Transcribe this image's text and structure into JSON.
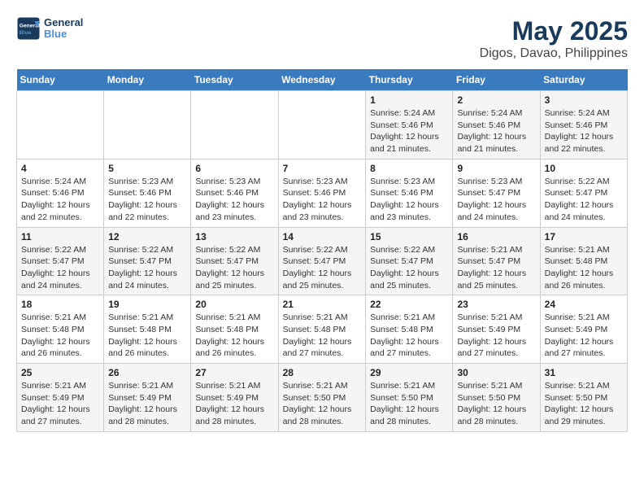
{
  "header": {
    "logo_general": "General",
    "logo_blue": "Blue",
    "title": "May 2025",
    "subtitle": "Digos, Davao, Philippines"
  },
  "calendar": {
    "days_of_week": [
      "Sunday",
      "Monday",
      "Tuesday",
      "Wednesday",
      "Thursday",
      "Friday",
      "Saturday"
    ],
    "weeks": [
      [
        {
          "day": "",
          "info": ""
        },
        {
          "day": "",
          "info": ""
        },
        {
          "day": "",
          "info": ""
        },
        {
          "day": "",
          "info": ""
        },
        {
          "day": "1",
          "info": "Sunrise: 5:24 AM\nSunset: 5:46 PM\nDaylight: 12 hours\nand 21 minutes."
        },
        {
          "day": "2",
          "info": "Sunrise: 5:24 AM\nSunset: 5:46 PM\nDaylight: 12 hours\nand 21 minutes."
        },
        {
          "day": "3",
          "info": "Sunrise: 5:24 AM\nSunset: 5:46 PM\nDaylight: 12 hours\nand 22 minutes."
        }
      ],
      [
        {
          "day": "4",
          "info": "Sunrise: 5:24 AM\nSunset: 5:46 PM\nDaylight: 12 hours\nand 22 minutes."
        },
        {
          "day": "5",
          "info": "Sunrise: 5:23 AM\nSunset: 5:46 PM\nDaylight: 12 hours\nand 22 minutes."
        },
        {
          "day": "6",
          "info": "Sunrise: 5:23 AM\nSunset: 5:46 PM\nDaylight: 12 hours\nand 23 minutes."
        },
        {
          "day": "7",
          "info": "Sunrise: 5:23 AM\nSunset: 5:46 PM\nDaylight: 12 hours\nand 23 minutes."
        },
        {
          "day": "8",
          "info": "Sunrise: 5:23 AM\nSunset: 5:46 PM\nDaylight: 12 hours\nand 23 minutes."
        },
        {
          "day": "9",
          "info": "Sunrise: 5:23 AM\nSunset: 5:47 PM\nDaylight: 12 hours\nand 24 minutes."
        },
        {
          "day": "10",
          "info": "Sunrise: 5:22 AM\nSunset: 5:47 PM\nDaylight: 12 hours\nand 24 minutes."
        }
      ],
      [
        {
          "day": "11",
          "info": "Sunrise: 5:22 AM\nSunset: 5:47 PM\nDaylight: 12 hours\nand 24 minutes."
        },
        {
          "day": "12",
          "info": "Sunrise: 5:22 AM\nSunset: 5:47 PM\nDaylight: 12 hours\nand 24 minutes."
        },
        {
          "day": "13",
          "info": "Sunrise: 5:22 AM\nSunset: 5:47 PM\nDaylight: 12 hours\nand 25 minutes."
        },
        {
          "day": "14",
          "info": "Sunrise: 5:22 AM\nSunset: 5:47 PM\nDaylight: 12 hours\nand 25 minutes."
        },
        {
          "day": "15",
          "info": "Sunrise: 5:22 AM\nSunset: 5:47 PM\nDaylight: 12 hours\nand 25 minutes."
        },
        {
          "day": "16",
          "info": "Sunrise: 5:21 AM\nSunset: 5:47 PM\nDaylight: 12 hours\nand 25 minutes."
        },
        {
          "day": "17",
          "info": "Sunrise: 5:21 AM\nSunset: 5:48 PM\nDaylight: 12 hours\nand 26 minutes."
        }
      ],
      [
        {
          "day": "18",
          "info": "Sunrise: 5:21 AM\nSunset: 5:48 PM\nDaylight: 12 hours\nand 26 minutes."
        },
        {
          "day": "19",
          "info": "Sunrise: 5:21 AM\nSunset: 5:48 PM\nDaylight: 12 hours\nand 26 minutes."
        },
        {
          "day": "20",
          "info": "Sunrise: 5:21 AM\nSunset: 5:48 PM\nDaylight: 12 hours\nand 26 minutes."
        },
        {
          "day": "21",
          "info": "Sunrise: 5:21 AM\nSunset: 5:48 PM\nDaylight: 12 hours\nand 27 minutes."
        },
        {
          "day": "22",
          "info": "Sunrise: 5:21 AM\nSunset: 5:48 PM\nDaylight: 12 hours\nand 27 minutes."
        },
        {
          "day": "23",
          "info": "Sunrise: 5:21 AM\nSunset: 5:49 PM\nDaylight: 12 hours\nand 27 minutes."
        },
        {
          "day": "24",
          "info": "Sunrise: 5:21 AM\nSunset: 5:49 PM\nDaylight: 12 hours\nand 27 minutes."
        }
      ],
      [
        {
          "day": "25",
          "info": "Sunrise: 5:21 AM\nSunset: 5:49 PM\nDaylight: 12 hours\nand 27 minutes."
        },
        {
          "day": "26",
          "info": "Sunrise: 5:21 AM\nSunset: 5:49 PM\nDaylight: 12 hours\nand 28 minutes."
        },
        {
          "day": "27",
          "info": "Sunrise: 5:21 AM\nSunset: 5:49 PM\nDaylight: 12 hours\nand 28 minutes."
        },
        {
          "day": "28",
          "info": "Sunrise: 5:21 AM\nSunset: 5:50 PM\nDaylight: 12 hours\nand 28 minutes."
        },
        {
          "day": "29",
          "info": "Sunrise: 5:21 AM\nSunset: 5:50 PM\nDaylight: 12 hours\nand 28 minutes."
        },
        {
          "day": "30",
          "info": "Sunrise: 5:21 AM\nSunset: 5:50 PM\nDaylight: 12 hours\nand 28 minutes."
        },
        {
          "day": "31",
          "info": "Sunrise: 5:21 AM\nSunset: 5:50 PM\nDaylight: 12 hours\nand 29 minutes."
        }
      ]
    ]
  }
}
